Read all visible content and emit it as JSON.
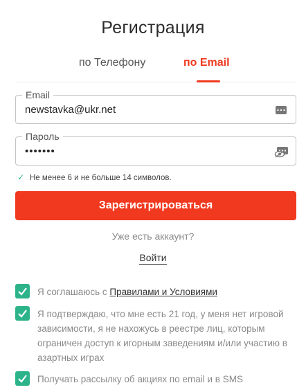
{
  "title": "Регистрация",
  "tabs": [
    {
      "label": "по Телефону",
      "active": false
    },
    {
      "label": "по Email",
      "active": true
    }
  ],
  "form": {
    "email": {
      "label": "Email",
      "value": "newstavka@ukr.net"
    },
    "password": {
      "label": "Пароль",
      "value": "•••••••"
    },
    "password_hint": "Не менее 6 и не больше 14 символов.",
    "submit_label": "Зарегистрироваться"
  },
  "account": {
    "question": "Уже есть аккаунт?",
    "login_label": "Войти"
  },
  "consents": [
    {
      "checked": true,
      "prefix": "Я соглашаюсь с ",
      "link_text": "Правилами и Условиями"
    },
    {
      "checked": true,
      "text": "Я подтверждаю, что мне есть 21 год, у меня нет игровой зависимости, я не нахожусь в реестре лиц, которым ограничен доступ к игорным заведениям и/или участию в азартных играх"
    },
    {
      "checked": true,
      "text": "Получать рассылку об акциях по email и в SMS"
    }
  ],
  "colors": {
    "accent": "#f0391f",
    "check": "#2db38a",
    "muted_text": "#8a8a8a"
  },
  "icons": {
    "email_field": "autofill-card-icon",
    "password_field": "hidden-password-icon",
    "hint": "checkmark-icon",
    "consent": "checkbox-checked-icon"
  }
}
